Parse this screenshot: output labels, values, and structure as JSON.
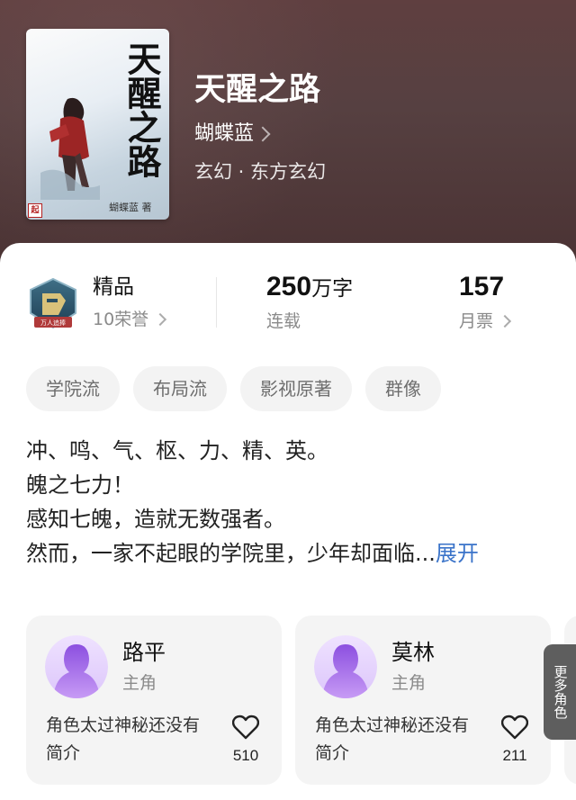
{
  "book": {
    "title": "天醒之路",
    "author": "蝴蝶蓝",
    "genre": "玄幻 · 东方玄幻",
    "cover_title": "天醒之路",
    "cover_author": "蝴蝶蓝 著"
  },
  "stats": {
    "honor_title": "精品",
    "honor_sub": "10荣誉",
    "words_number": "250",
    "words_unit": "万字",
    "words_status": "连载",
    "monthly_votes": "157",
    "monthly_label": "月票"
  },
  "tags": [
    "学院流",
    "布局流",
    "影视原著",
    "群像"
  ],
  "intro": {
    "lines": [
      "冲、鸣、气、枢、力、精、英。",
      "魄之七力！",
      "感知七魄，造就无数强者。",
      "然而，一家不起眼的学院里，少年却面临..."
    ],
    "expand_label": "展开"
  },
  "characters": [
    {
      "name": "路平",
      "role": "主角",
      "description": "角色太过神秘还没有简介",
      "likes": "510"
    },
    {
      "name": "莫林",
      "role": "主角",
      "description": "角色太过神秘还没有简介",
      "likes": "211"
    }
  ],
  "more_roles_label": "更多角色",
  "colors": {
    "header_bg": "#564041",
    "accent_link": "#3a73c9",
    "tag_bg": "#f3f3f3",
    "card_bg": "#f4f4f4",
    "avatar_purple": "#a46de0"
  },
  "icons": [
    "chevron-right-icon",
    "honor-badge-icon",
    "heart-icon",
    "avatar-silhouette-icon"
  ]
}
